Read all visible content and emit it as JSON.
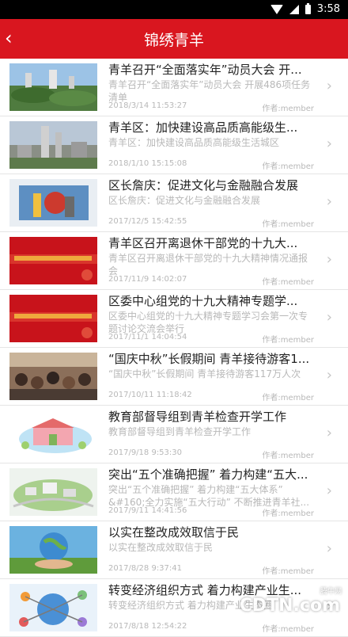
{
  "status_bar": {
    "time": "3:58"
  },
  "header": {
    "title": "锦绣青羊"
  },
  "items": [
    {
      "title": "青羊召开“全面落实年”动员大会 开...",
      "summary": "青羊召开“全面落实年”动员大会 开展486项任务清单",
      "date": "2018/3/14 11:53:27",
      "author": "作者:member"
    },
    {
      "title": "青羊区：加快建设高品质高能级生...",
      "summary": "青羊区：加快建设高品质高能级生活城区",
      "date": "2018/1/10 15:15:08",
      "author": "作者:member"
    },
    {
      "title": "区长詹庆：促进文化与金融融合发展",
      "summary": "区长詹庆：促进文化与金融融合发展",
      "date": "2017/12/5 15:42:55",
      "author": "作者:member"
    },
    {
      "title": "青羊区召开离退休干部党的十九大...",
      "summary": "青羊区召开离退休干部党的十九大精神情况通报会",
      "date": "2017/11/9 14:02:07",
      "author": "作者:member"
    },
    {
      "title": "区委中心组党的十九大精神专题学...",
      "summary": "区委中心组党的十九大精神专题学习会第一次专题讨论交流会举行",
      "date": "2017/11/1 14:04:54",
      "author": "作者:member"
    },
    {
      "title": "“国庆中秋”长假期间 青羊接待游客1...",
      "summary": "“国庆中秋”长假期间 青羊接待游客117万人次",
      "date": "2017/10/11 11:18:42",
      "author": "作者:member"
    },
    {
      "title": "教育部督导组到青羊检查开学工作",
      "summary": "教育部督导组到青羊检查开学工作",
      "date": "2017/9/18 9:53:30",
      "author": "作者:member"
    },
    {
      "title": "突出“五个准确把握” 着力构建“五大...",
      "summary": "突出“五个准确把握” 着力构建“五大体系” &#160;全力实施“五大行动” 不断推进青羊社...",
      "date": "2017/9/11 14:41:56",
      "author": "作者:member"
    },
    {
      "title": "以实在整改成效取信于民",
      "summary": "以实在整改成效取信于民",
      "date": "2017/8/28 9:37:41",
      "author": "作者:member"
    },
    {
      "title": "转变经济组织方式 着力构建产业生...",
      "summary": "转变经济组织方式 着力构建产业生态圈",
      "date": "2017/8/18 12:54:22",
      "author": "作者:member"
    }
  ],
  "watermark": {
    "brand": "CDTN.com",
    "tag": "腾牛网"
  },
  "colors": {
    "accent": "#d9161f",
    "meta_text": "#b8b8b8"
  }
}
